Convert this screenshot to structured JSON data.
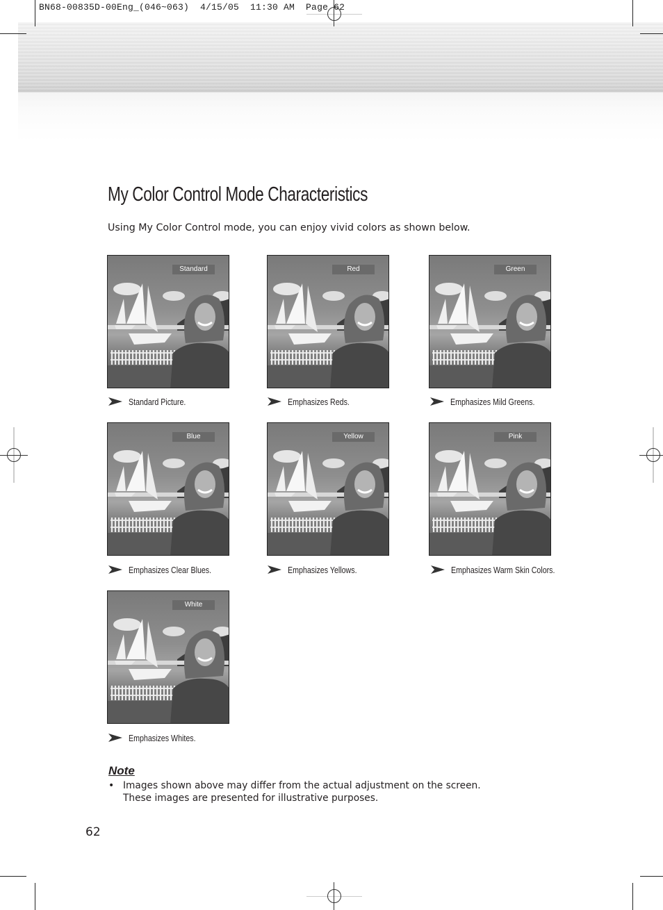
{
  "print_slug": "BN68-00835D-00Eng_(046~063)  4/15/05  11:30 AM  Page 62",
  "title": "My Color Control Mode Characteristics",
  "intro": "Using My Color Control mode, you can enjoy vivid colors as shown below.",
  "modes": [
    {
      "label": "Standard",
      "caption": "Standard Picture."
    },
    {
      "label": "Red",
      "caption": "Emphasizes Reds."
    },
    {
      "label": "Green",
      "caption": "Emphasizes Mild Greens."
    },
    {
      "label": "Blue",
      "caption": "Emphasizes Clear Blues."
    },
    {
      "label": "Yellow",
      "caption": "Emphasizes Yellows."
    },
    {
      "label": "Pink",
      "caption": "Emphasizes Warm Skin Colors."
    },
    {
      "label": "White",
      "caption": "Emphasizes Whites."
    }
  ],
  "note": {
    "heading": "Note",
    "bullet": "•",
    "lines": [
      "Images shown above may differ from the actual adjustment on the screen.",
      "These images are presented for illustrative purposes."
    ]
  },
  "page_number": "62",
  "icons": {
    "caption_arrow": "arrowhead-right-icon",
    "registration": "registration-mark-icon"
  }
}
